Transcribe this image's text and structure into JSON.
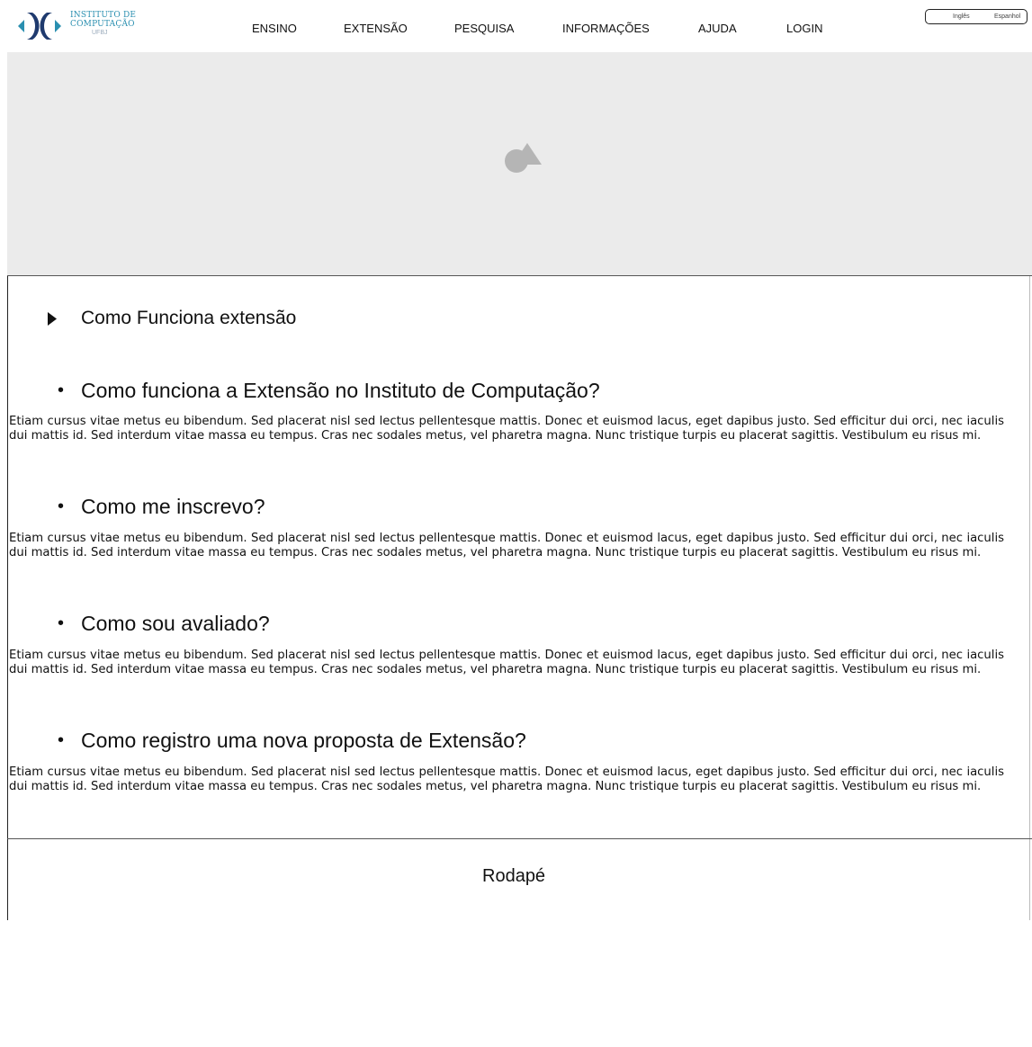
{
  "header": {
    "logo": {
      "line1": "INSTITUTO DE",
      "line2": "COMPUTAÇÃO",
      "line3": "UFBJ",
      "icon": "ic-logo"
    },
    "nav": [
      "ENSINO",
      "EXTENSÃO",
      "PESQUISA",
      "INFORMAÇÕES",
      "AJUDA",
      "LOGIN"
    ],
    "languages": [
      "Inglês",
      "Espanhol"
    ]
  },
  "banner": {
    "icon": "image-placeholder-icon"
  },
  "section": {
    "icon": "triangle-right-icon",
    "title": "Como Funciona extensão"
  },
  "faq": [
    {
      "bullet": "•",
      "question": "Como funciona a Extensão no Instituto de Computação?",
      "answer": "Etiam cursus vitae metus eu bibendum. Sed placerat nisl sed lectus pellentesque mattis. Donec et euismod lacus, eget dapibus justo. Sed efficitur dui orci, nec iaculis dui mattis id. Sed interdum vitae massa eu tempus. Cras nec sodales metus, vel pharetra magna. Nunc tristique turpis eu placerat sagittis. Vestibulum eu risus mi."
    },
    {
      "bullet": "•",
      "question": "Como me inscrevo?",
      "answer": "Etiam cursus vitae metus eu bibendum. Sed placerat nisl sed lectus pellentesque mattis. Donec et euismod lacus, eget dapibus justo. Sed efficitur dui orci, nec iaculis dui mattis id. Sed interdum vitae massa eu tempus. Cras nec sodales metus, vel pharetra magna. Nunc tristique turpis eu placerat sagittis. Vestibulum eu risus mi."
    },
    {
      "bullet": "•",
      "question": "Como sou avaliado?",
      "answer": "Etiam cursus vitae metus eu bibendum. Sed placerat nisl sed lectus pellentesque mattis. Donec et euismod lacus, eget dapibus justo. Sed efficitur dui orci, nec iaculis dui mattis id. Sed interdum vitae massa eu tempus. Cras nec sodales metus, vel pharetra magna. Nunc tristique turpis eu placerat sagittis. Vestibulum eu risus mi."
    },
    {
      "bullet": "•",
      "question": "Como registro uma nova proposta de Extensão?",
      "answer": "Etiam cursus vitae metus eu bibendum. Sed placerat nisl sed lectus pellentesque mattis. Donec et euismod lacus, eget dapibus justo. Sed efficitur dui orci, nec iaculis dui mattis id. Sed interdum vitae massa eu tempus. Cras nec sodales metus, vel pharetra magna. Nunc tristique turpis eu placerat sagittis. Vestibulum eu risus mi."
    }
  ],
  "footer": {
    "text": "Rodapé"
  },
  "colors": {
    "logo_blue": "#2a8fb0",
    "logo_dark": "#1f3a6e",
    "banner_bg": "#ebebeb"
  }
}
